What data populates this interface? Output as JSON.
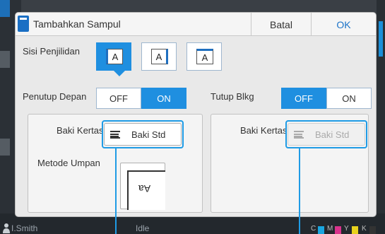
{
  "dialog": {
    "title": "Tambahkan Sampul",
    "cancel_label": "Batal",
    "ok_label": "OK"
  },
  "binding": {
    "label": "Sisi Penjilidan",
    "options": [
      {
        "glyph": "A",
        "side": "left",
        "selected": true
      },
      {
        "glyph": "A",
        "side": "right",
        "selected": false
      },
      {
        "glyph": "A",
        "side": "top",
        "selected": false
      }
    ]
  },
  "front_cover": {
    "label": "Penutup Depan",
    "off_label": "OFF",
    "on_label": "ON",
    "value": "ON",
    "tray_label": "Baki Kertas",
    "tray_value": "Baki Std",
    "feed_label": "Metode Umpan",
    "feed_glyph": "Aa"
  },
  "back_cover": {
    "label": "Tutup Blkg",
    "off_label": "OFF",
    "on_label": "ON",
    "value": "OFF",
    "tray_label": "Baki Kertas",
    "tray_value": "Baki Std",
    "tray_disabled": true
  },
  "status_bar": {
    "user": "I.Smith",
    "state": "Idle",
    "toner_labels": [
      "C",
      "M",
      "Y",
      "K"
    ]
  },
  "colors": {
    "accent": "#1f8fe0",
    "ok_text": "#1a73c8",
    "callout": "#1f9be5"
  }
}
